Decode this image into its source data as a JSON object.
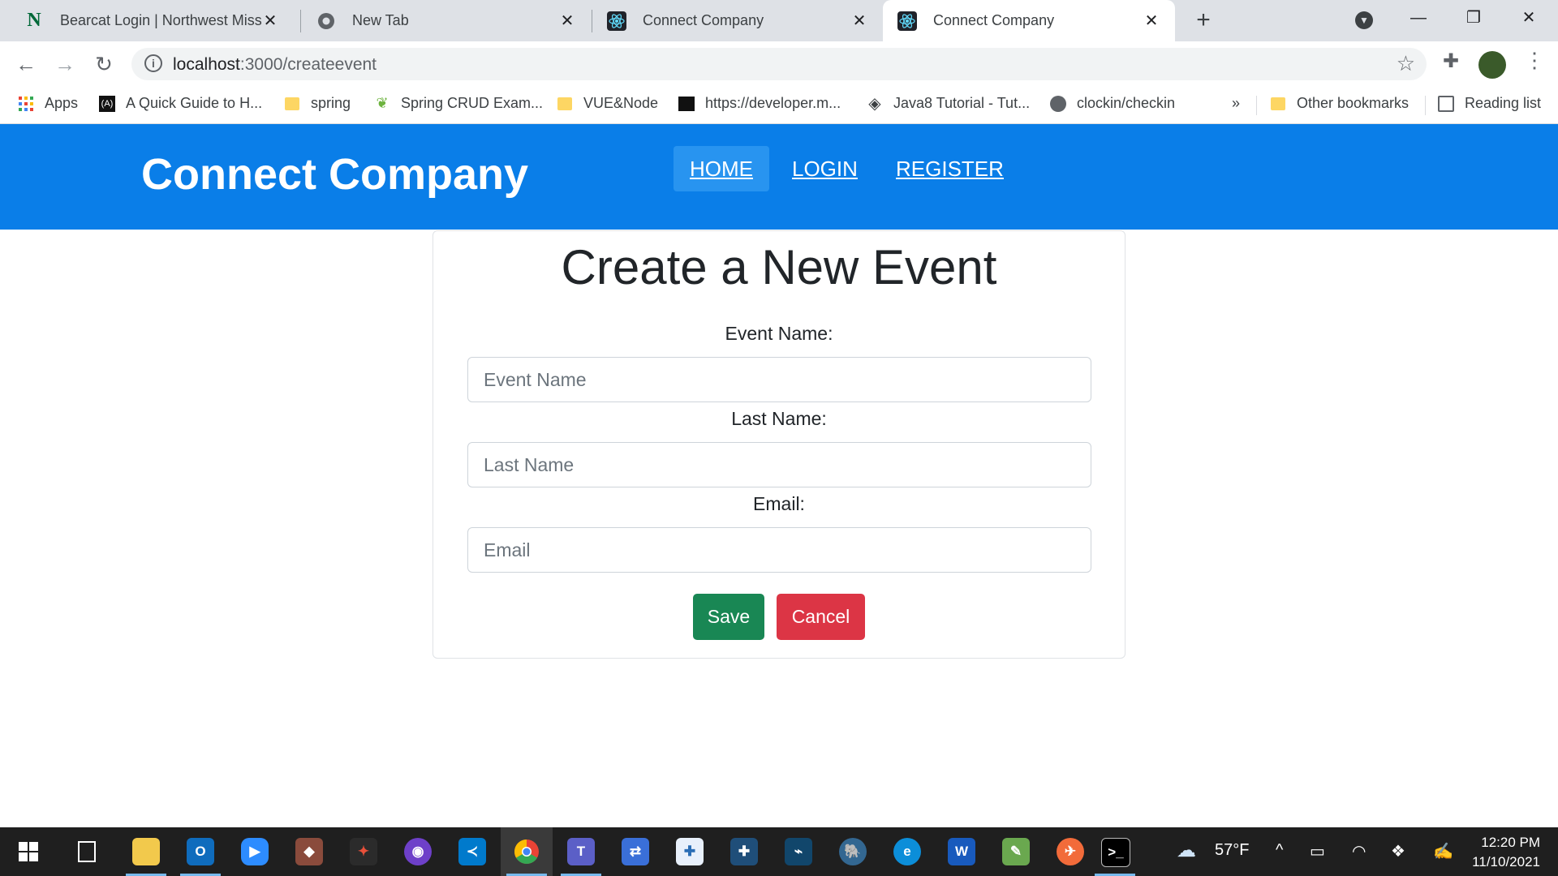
{
  "browser": {
    "tabs": [
      {
        "title": "Bearcat Login | Northwest Missou",
        "icon": "northwest-n-icon"
      },
      {
        "title": "New Tab",
        "icon": "chrome-icon"
      },
      {
        "title": "Connect Company",
        "icon": "react-icon"
      },
      {
        "title": "Connect Company",
        "icon": "react-icon",
        "active": true
      }
    ],
    "url_host": "localhost",
    "url_path": ":3000/createevent",
    "bookmarks": [
      {
        "label": "Apps",
        "icon": "apps-grid-icon"
      },
      {
        "label": "A Quick Guide to H...",
        "icon": "bookmark-site-icon"
      },
      {
        "label": "spring",
        "icon": "folder-icon"
      },
      {
        "label": "Spring CRUD Exam...",
        "icon": "spring-leaf-icon"
      },
      {
        "label": "VUE&Node",
        "icon": "folder-icon"
      },
      {
        "label": "https://developer.m...",
        "icon": "bookmark-site-icon"
      },
      {
        "label": "Java8 Tutorial - Tut...",
        "icon": "diamond-icon"
      },
      {
        "label": "clockin/checkin",
        "icon": "globe-icon"
      },
      {
        "label": "Other bookmarks",
        "icon": "folder-icon"
      },
      {
        "label": "Reading list",
        "icon": "reading-list-icon"
      }
    ]
  },
  "app": {
    "brand": "Connect Company",
    "nav": {
      "home": "HOME",
      "login": "LOGIN",
      "register": "REGISTER"
    },
    "form": {
      "title": "Create a New Event",
      "event_name_label": "Event Name:",
      "event_name_placeholder": "Event Name",
      "last_name_label": "Last Name:",
      "last_name_placeholder": "Last Name",
      "email_label": "Email:",
      "email_placeholder": "Email",
      "save": "Save",
      "cancel": "Cancel"
    },
    "colors": {
      "nav": "#0a7ee8",
      "save": "#198754",
      "cancel": "#dc3545"
    }
  },
  "taskbar": {
    "weather": "57°F",
    "time": "12:20 PM",
    "date": "11/10/2021"
  }
}
